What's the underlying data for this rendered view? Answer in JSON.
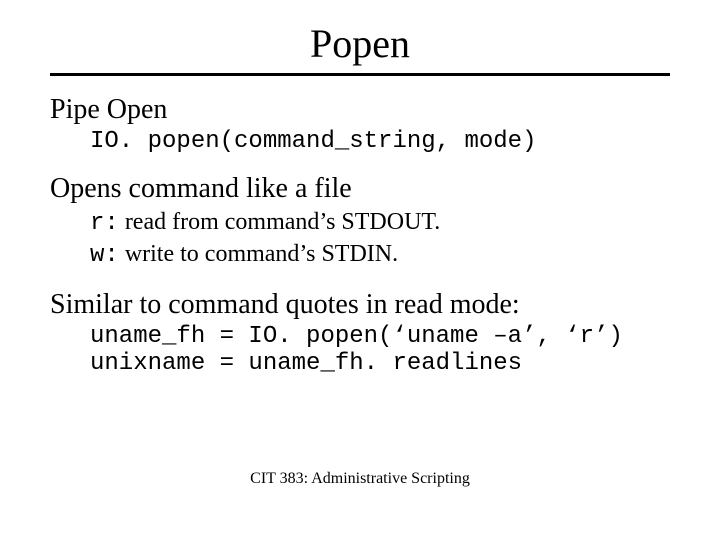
{
  "title": "Popen",
  "section1": {
    "heading": "Pipe Open",
    "code": "IO. popen(command_string, mode)"
  },
  "section2": {
    "heading": "Opens command like a file",
    "r_key": "r:",
    "r_desc": " read from command’s STDOUT.",
    "w_key": "w:",
    "w_desc": " write to command’s STDIN."
  },
  "section3": {
    "heading": "Similar to command quotes in read mode:",
    "line1": "uname_fh = IO. popen(‘uname –a’, ‘r’)",
    "line2": "unixname = uname_fh. readlines"
  },
  "footer": "CIT 383: Administrative Scripting"
}
